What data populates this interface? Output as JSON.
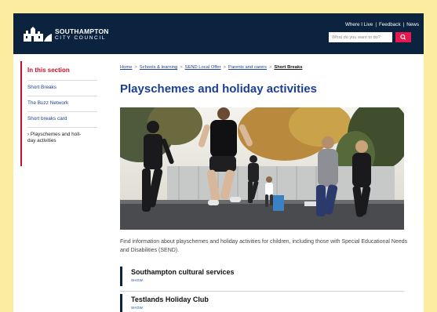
{
  "header": {
    "logo_line1": "SOUTHAMPTON",
    "logo_line2": "CITY COUNCIL",
    "links": [
      "Where I Live",
      "Feedback",
      "News"
    ],
    "search": {
      "placeholder": "What do you want to do?"
    },
    "colors": {
      "background": "#0c2340",
      "search_button": "#e5194f"
    }
  },
  "sidebar": {
    "title": "In this section",
    "items": [
      {
        "label": "Short Breaks"
      },
      {
        "label": "The Buzz Network"
      },
      {
        "label": "Short breaks card"
      },
      {
        "label": "› Playschemes and holl-\nday activities"
      }
    ]
  },
  "breadcrumb": {
    "items": [
      "Home",
      "Schools & learning",
      "SEND Local Offer",
      "Parents and carers"
    ],
    "current": "Short Breaks"
  },
  "main": {
    "title": "Playschemes and holiday activities",
    "hero_image": "group-running-outdoors-photo",
    "intro": "Find information about playschemes and holiday activities for children, including those with Special Educational Needs and Disabilities (SEND).",
    "accordions": [
      {
        "title": "Southampton cultural services",
        "toggle": "SHOW"
      },
      {
        "title": "Testlands Holiday Club",
        "toggle": "SHOW"
      }
    ]
  },
  "colors": {
    "page_border": "#fcec9f",
    "accent_red": "#c8102e",
    "link_blue": "#1c3f94"
  }
}
